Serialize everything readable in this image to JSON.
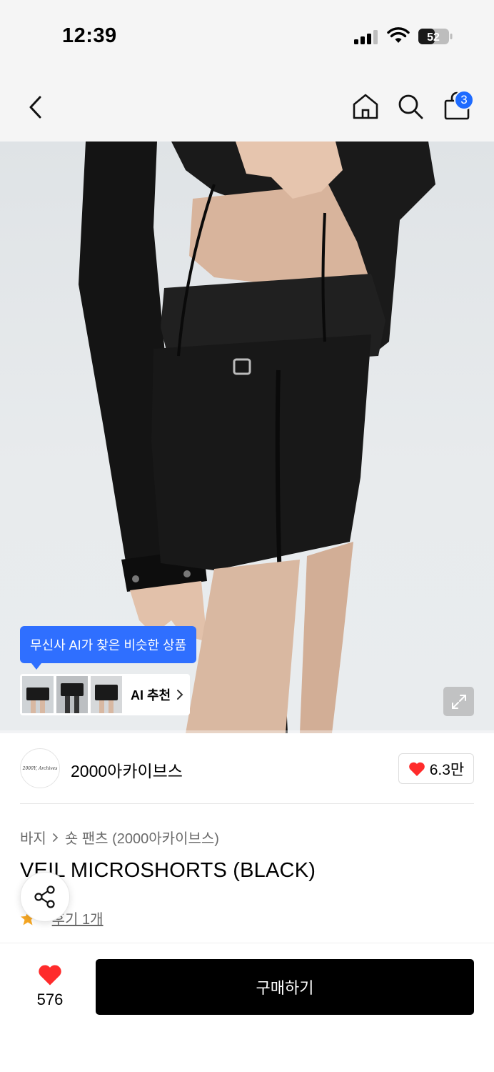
{
  "status_bar": {
    "time": "12:39",
    "battery": "52"
  },
  "nav": {
    "cart_count": "3",
    "icons": [
      "back-chevron-icon",
      "home-icon",
      "search-icon",
      "shopping-bag-icon"
    ]
  },
  "hero": {
    "ai_tooltip": "무신사 AI가 찾은 비슷한 상품",
    "ai_recommend_label": "AI 추천",
    "colors": {
      "accent": "#2f6fff",
      "cart_badge": "#1e6bff",
      "heart": "#ff2b2b"
    }
  },
  "brand": {
    "logo_text": "2000Y, Archives",
    "name": "2000아카이브스",
    "likes": "6.3만"
  },
  "product": {
    "breadcrumb": [
      "바지",
      "숏 팬츠 (2000아카이브스)"
    ],
    "title": "VEIL MICROSHORTS (BLACK)",
    "review_label": "후기 1개"
  },
  "bottom": {
    "wish_count": "576",
    "buy_label": "구매하기"
  }
}
